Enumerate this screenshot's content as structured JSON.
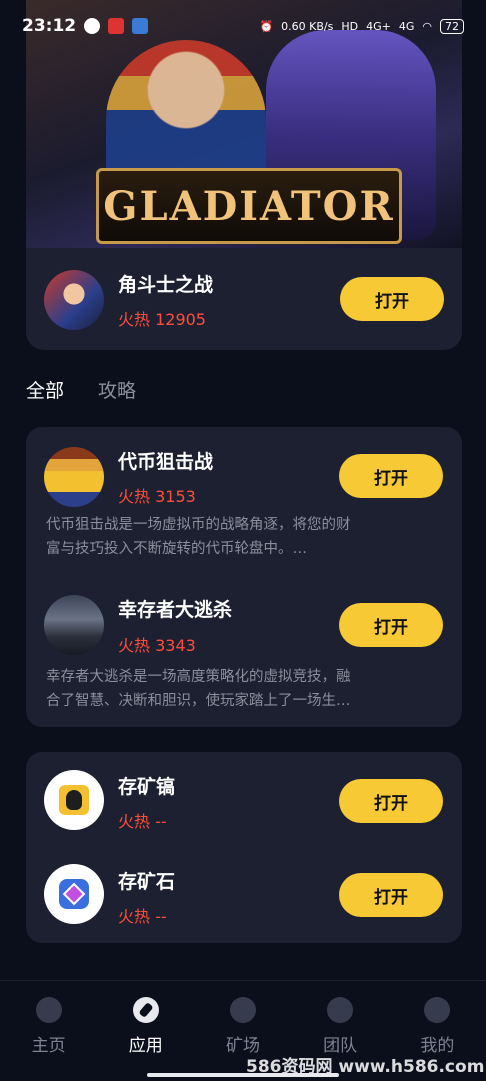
{
  "status_bar": {
    "time": "23:12",
    "net_speed": "0.60 KB/s",
    "signal_1": "4G+",
    "signal_2": "4G",
    "battery": "72"
  },
  "featured": {
    "banner_text": "GLADIATOR",
    "name": "角斗士之战",
    "heat": "火热 12905",
    "button": "打开"
  },
  "tabs": [
    {
      "label": "全部",
      "active": true
    },
    {
      "label": "攻略",
      "active": false
    }
  ],
  "apps_group_1": [
    {
      "name": "代币狙击战",
      "heat": "火热 3153",
      "button": "打开",
      "desc_line1": "代币狙击战是一场虚拟币的战略角逐，将您的财",
      "desc_line2": "富与技巧投入不断旋转的代币轮盘中。…"
    },
    {
      "name": "幸存者大逃杀",
      "heat": "火热 3343",
      "button": "打开",
      "desc_line1": "幸存者大逃杀是一场高度策略化的虚拟竞技，融",
      "desc_line2": "合了智慧、决断和胆识，使玩家踏上了一场生…"
    }
  ],
  "apps_group_2": [
    {
      "name": "存矿镐",
      "heat": "火热 --",
      "button": "打开"
    },
    {
      "name": "存矿石",
      "heat": "火热 --",
      "button": "打开"
    }
  ],
  "bottom_nav": [
    {
      "label": "主页",
      "active": false
    },
    {
      "label": "应用",
      "active": true
    },
    {
      "label": "矿场",
      "active": false
    },
    {
      "label": "团队",
      "active": false
    },
    {
      "label": "我的",
      "active": false
    }
  ],
  "watermark": "586资码网 www.h586.com"
}
